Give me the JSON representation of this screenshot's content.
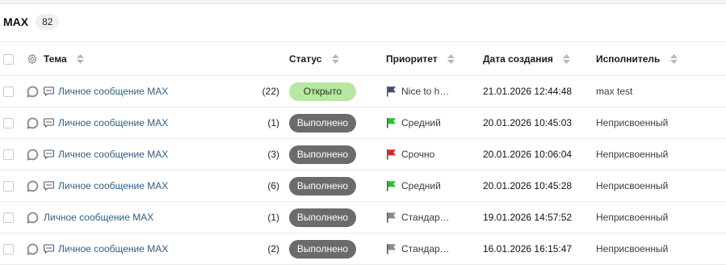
{
  "list": {
    "title": "MAX",
    "count": "82"
  },
  "columns": {
    "topic": "Тема",
    "status": "Статус",
    "priority": "Приоритет",
    "created": "Дата создания",
    "assignee": "Исполнитель"
  },
  "rows": [
    {
      "topic": "Личное сообщение MAX",
      "has_msg_icon": true,
      "count": "(22)",
      "status": "Открыто",
      "status_kind": "open",
      "priority": "Nice to have",
      "flag_color": "#3d4b6b",
      "created": "21.01.2026 12:44:48",
      "assignee": "max test"
    },
    {
      "topic": "Личное сообщение MAX",
      "has_msg_icon": true,
      "count": "(1)",
      "status": "Выполнено",
      "status_kind": "done",
      "priority": "Средний",
      "flag_color": "#27c42a",
      "created": "20.01.2026 10:45:03",
      "assignee": "Неприсвоенный"
    },
    {
      "topic": "Личное сообщение MAX",
      "has_msg_icon": true,
      "count": "(3)",
      "status": "Выполнено",
      "status_kind": "done",
      "priority": "Срочно",
      "flag_color": "#e02424",
      "created": "20.01.2026 10:06:04",
      "assignee": "Неприсвоенный"
    },
    {
      "topic": "Личное сообщение MAX",
      "has_msg_icon": true,
      "count": "(6)",
      "status": "Выполнено",
      "status_kind": "done",
      "priority": "Средний",
      "flag_color": "#27c42a",
      "created": "20.01.2026 10:45:28",
      "assignee": "Неприсвоенный"
    },
    {
      "topic": "Личное сообщение MAX",
      "has_msg_icon": false,
      "count": "(1)",
      "status": "Выполнено",
      "status_kind": "done",
      "priority": "Стандартный",
      "flag_color": "#8a8a8a",
      "created": "19.01.2026 14:57:52",
      "assignee": "Неприсвоенный"
    },
    {
      "topic": "Личное сообщение MAX",
      "has_msg_icon": true,
      "count": "(2)",
      "status": "Выполнено",
      "status_kind": "done",
      "priority": "Стандартный",
      "flag_color": "#8a8a8a",
      "created": "16.01.2026 16:15:47",
      "assignee": "Неприсвоенный"
    }
  ]
}
